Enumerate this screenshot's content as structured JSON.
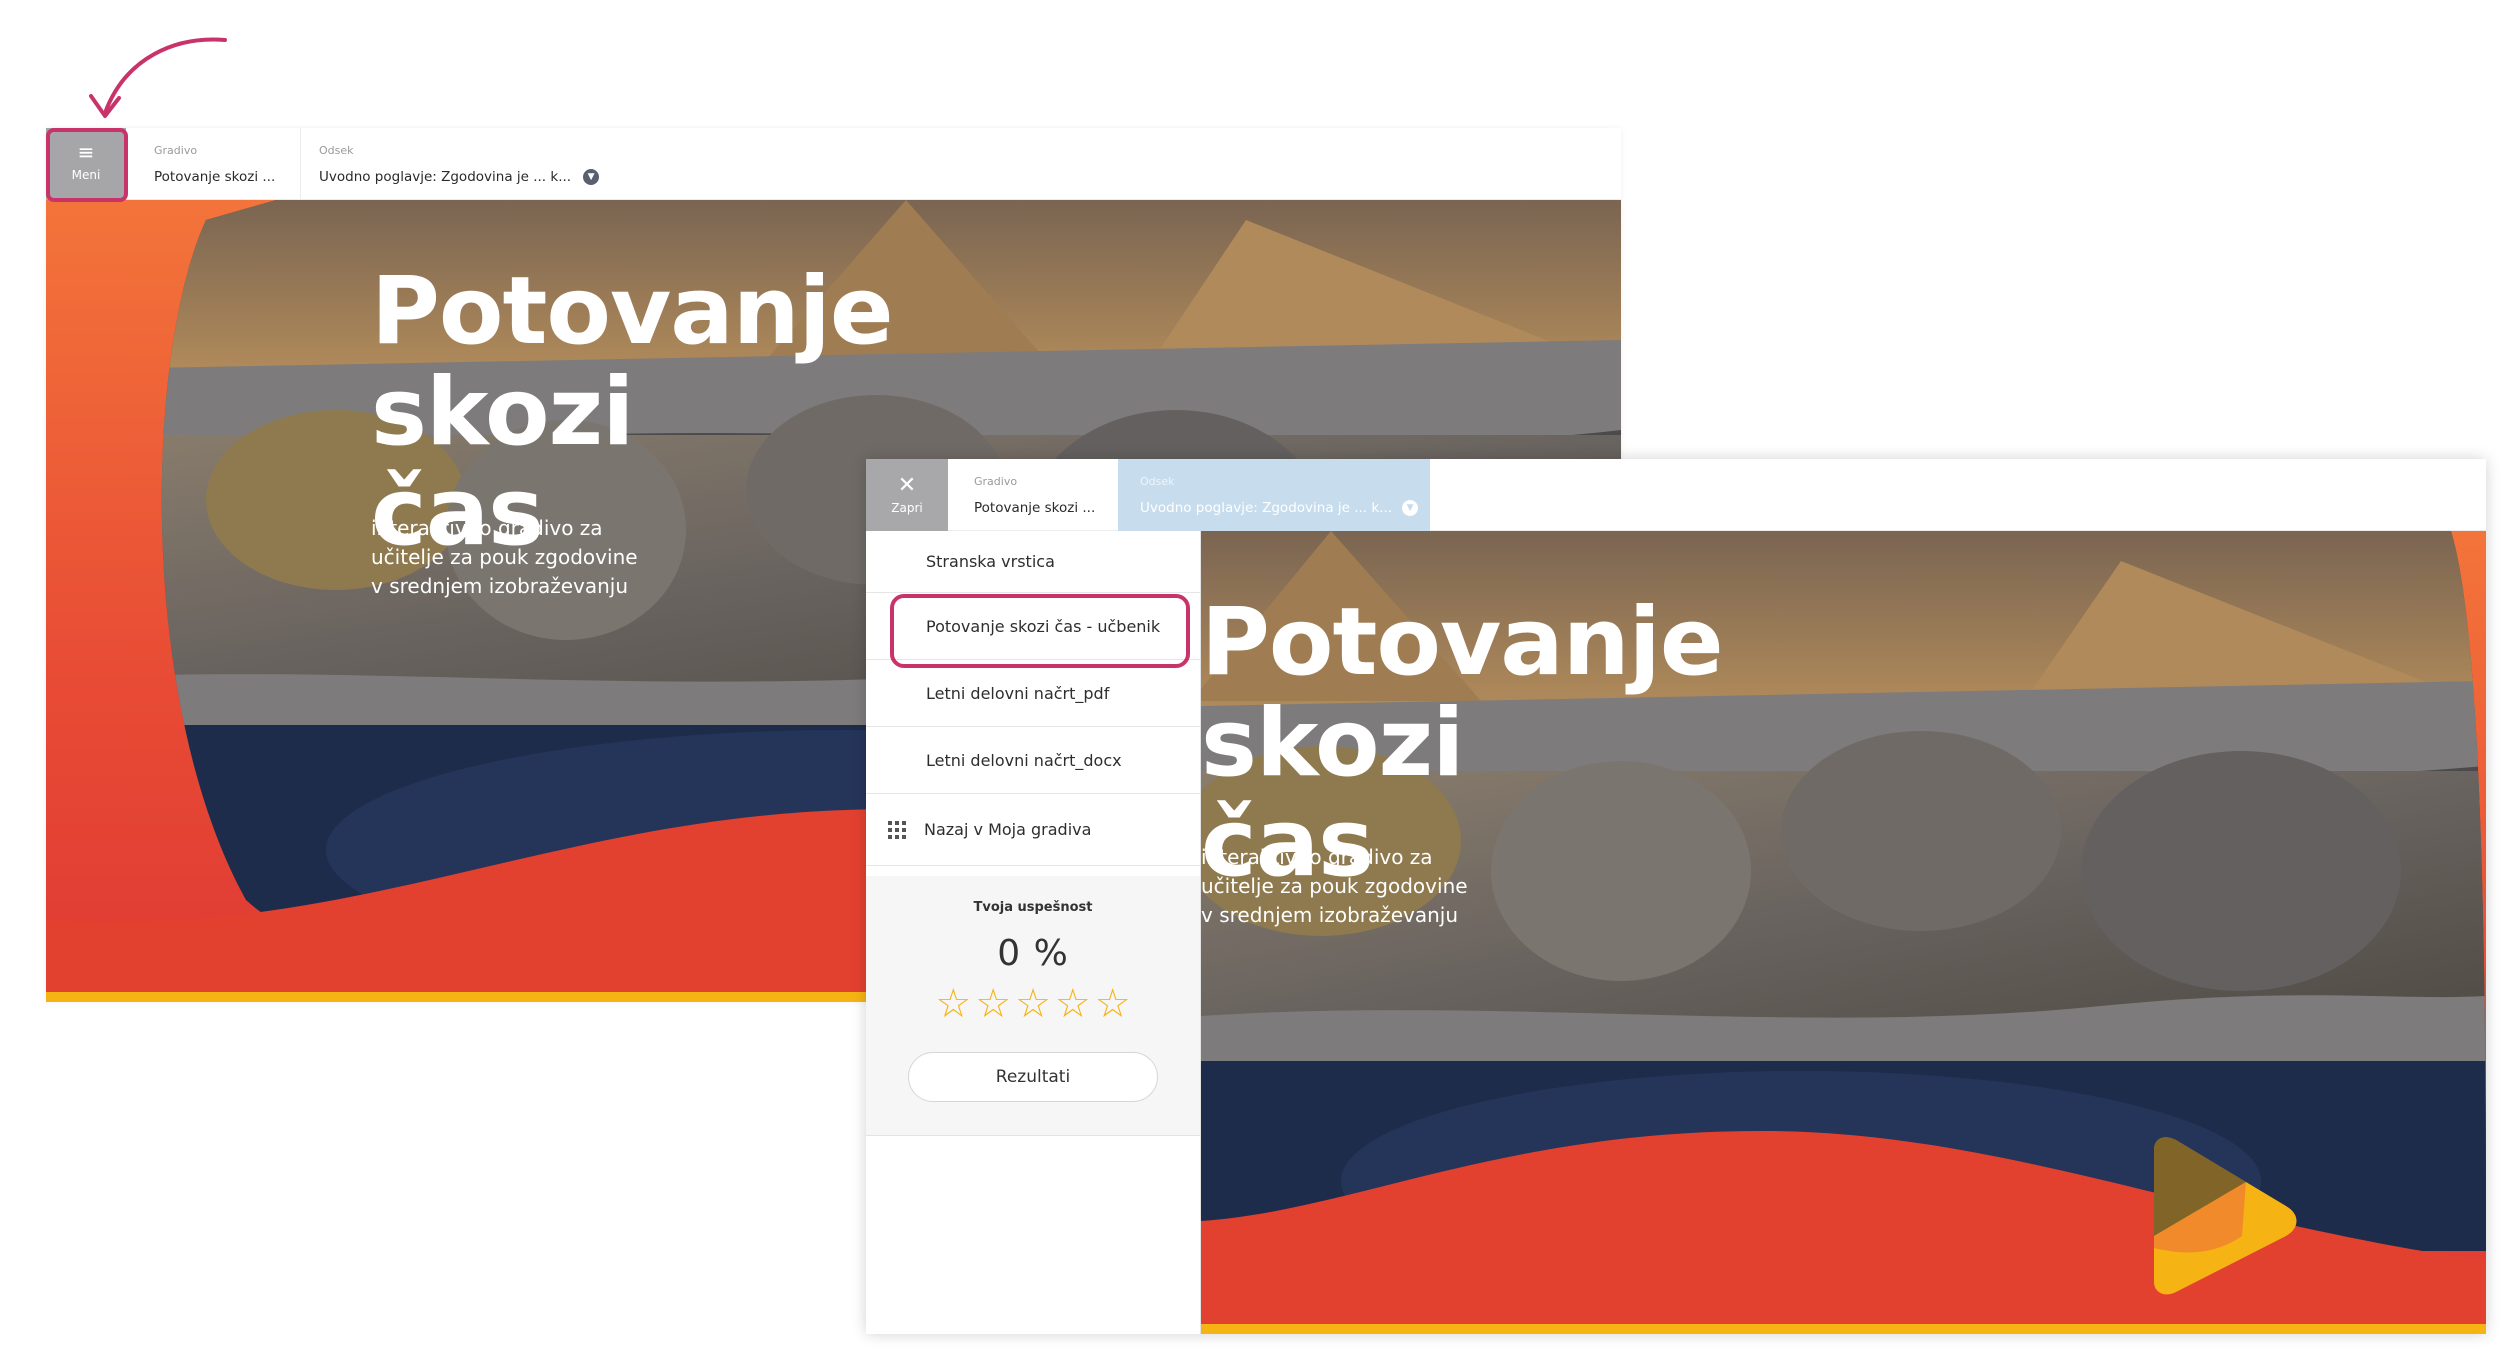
{
  "screen1": {
    "menu_label": "Meni",
    "gradivo_label": "Gradivo",
    "gradivo_value": "Potovanje skozi ...",
    "odsek_label": "Odsek",
    "odsek_value": "Uvodno poglavje: Zgodovina je ... k...",
    "hero": {
      "title_line1": "Potovanje skozi",
      "title_line2": "čas",
      "sub_line1": "interaktivno gradivo za",
      "sub_line2": "učitelje za pouk zgodovine",
      "sub_line3": "v srednjem izobraževanju"
    }
  },
  "screen2": {
    "close_label": "Zapri",
    "gradivo_label": "Gradivo",
    "gradivo_value": "Potovanje skozi ...",
    "odsek_label": "Odsek",
    "odsek_value": "Uvodno poglavje: Zgodovina je ... k...",
    "menu_items": [
      {
        "label": "Stranska vrstica"
      },
      {
        "label": "Potovanje skozi čas - učbenik"
      },
      {
        "label": "Letni delovni načrt_pdf"
      },
      {
        "label": "Letni delovni načrt_docx"
      },
      {
        "label": "Nazaj v Moja gradiva"
      }
    ],
    "score": {
      "label": "Tvoja uspešnost",
      "value": "0 %",
      "stars_filled": 0,
      "stars_total": 5,
      "button_label": "Rezultati"
    },
    "hero": {
      "title_line1": "Potovanje skozi",
      "title_line2": "čas",
      "sub_line1": "interaktivno gradivo za",
      "sub_line2": "učitelje za pouk zgodovine",
      "sub_line3": "v srednjem izobraževanju"
    }
  },
  "icons": {
    "menu": "hamburger-icon",
    "close": "close-icon",
    "chevron": "chevron-down-icon",
    "grid": "grid-icon",
    "star": "star-outline-icon",
    "logo": "play-logo"
  },
  "colors": {
    "highlight": "#c8336a",
    "orange": "#f3743a",
    "red": "#df3a33",
    "yellow": "#f6b414",
    "navy": "#1e2c4c",
    "button_gray": "#a6a6a8"
  }
}
